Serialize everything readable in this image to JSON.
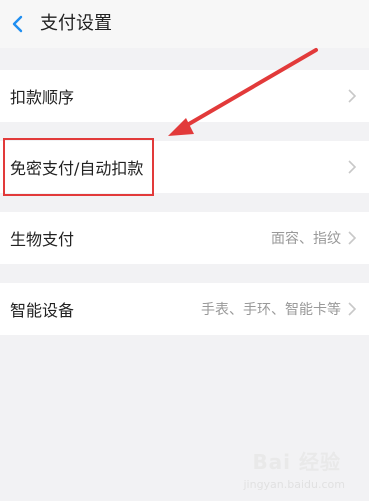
{
  "header": {
    "title": "支付设置",
    "back_icon": "chevron-left-icon",
    "accent": "#1f8ef1"
  },
  "rows": [
    {
      "label": "扣款顺序",
      "value": ""
    },
    {
      "label": "免密支付/自动扣款",
      "value": ""
    },
    {
      "label": "生物支付",
      "value": "面容、指纹"
    },
    {
      "label": "智能设备",
      "value": "手表、手环、智能卡等"
    }
  ],
  "annotation": {
    "color": "#e23a3a"
  },
  "watermark": {
    "text": "Bai 经验",
    "sub": "jingyan.baidu.com"
  }
}
